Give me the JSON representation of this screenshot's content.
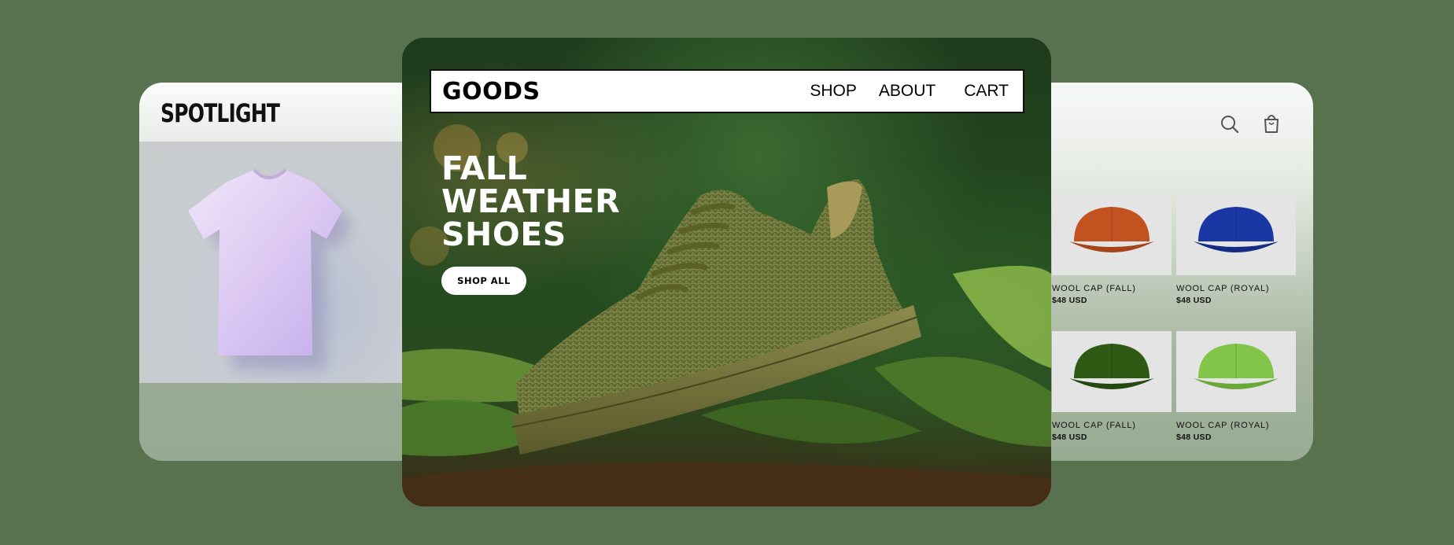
{
  "colors": {
    "page_background": "#587250",
    "accent_dark": "#111111",
    "button_bg": "#ffffff"
  },
  "left_card": {
    "brand": "SPOTLIGHT",
    "image": "lavender-tshirt"
  },
  "center_card": {
    "nav": {
      "brand": "GOODS",
      "links": [
        "SHOP",
        "ABOUT",
        "CART"
      ]
    },
    "hero": {
      "title_lines": [
        "FALL",
        "WEATHER",
        "SHOES"
      ],
      "cta_label": "SHOP ALL",
      "image": "olive-knit-sneaker-on-leaves"
    }
  },
  "right_card": {
    "icons": [
      "search-icon",
      "shopping-bag-icon"
    ],
    "products": [
      {
        "name": "WOOL CAP (FALL)",
        "price": "$48 USD",
        "color": "#c2521f"
      },
      {
        "name": "WOOL CAP (ROYAL)",
        "price": "$48 USD",
        "color": "#1b37a4"
      },
      {
        "name": "WOOL CAP (FALL)",
        "price": "$48 USD",
        "color": "#2f5a14"
      },
      {
        "name": "WOOL CAP (ROYAL)",
        "price": "$48 USD",
        "color": "#82c548"
      }
    ]
  }
}
